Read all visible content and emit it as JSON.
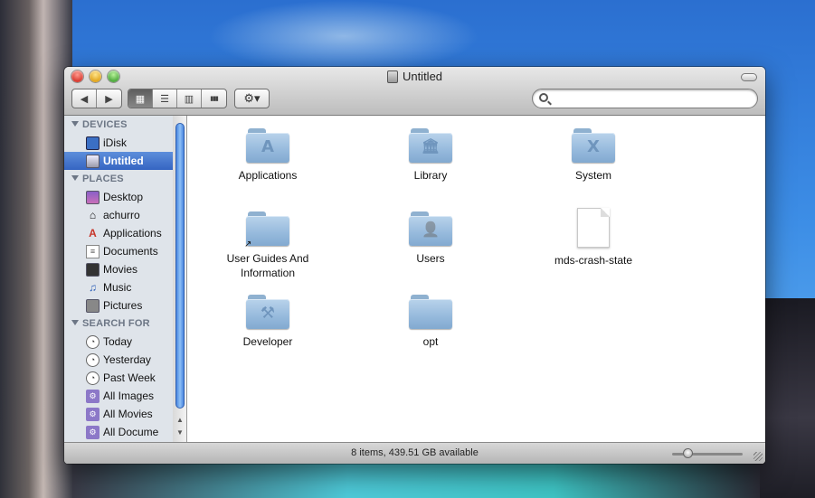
{
  "window": {
    "title": "Untitled"
  },
  "toolbar": {
    "back": "◀",
    "forward": "▶",
    "view_icon": "▦",
    "view_list": "☰",
    "view_columns": "▥",
    "view_coverflow": "▮▮▮",
    "action": "⚙▾",
    "search_placeholder": ""
  },
  "sidebar": {
    "devices_header": "DEVICES",
    "devices": [
      {
        "label": "iDisk",
        "icon": "idisk-icon"
      },
      {
        "label": "Untitled",
        "icon": "hard-drive-icon"
      }
    ],
    "places_header": "PLACES",
    "places": [
      {
        "label": "Desktop",
        "icon": "desktop-icon"
      },
      {
        "label": "achurro",
        "icon": "home-icon"
      },
      {
        "label": "Applications",
        "icon": "applications-icon"
      },
      {
        "label": "Documents",
        "icon": "documents-icon"
      },
      {
        "label": "Movies",
        "icon": "movies-icon"
      },
      {
        "label": "Music",
        "icon": "music-icon"
      },
      {
        "label": "Pictures",
        "icon": "pictures-icon"
      }
    ],
    "search_header": "SEARCH FOR",
    "search": [
      {
        "label": "Today",
        "icon": "clock-icon"
      },
      {
        "label": "Yesterday",
        "icon": "clock-icon"
      },
      {
        "label": "Past Week",
        "icon": "clock-icon"
      },
      {
        "label": "All Images",
        "icon": "smart-folder-icon"
      },
      {
        "label": "All Movies",
        "icon": "smart-folder-icon"
      },
      {
        "label": "All Docume",
        "icon": "smart-folder-icon"
      }
    ]
  },
  "files": [
    {
      "name": "Applications",
      "emblem": "A"
    },
    {
      "name": "Library",
      "emblem": "🏛"
    },
    {
      "name": "System",
      "emblem": "X"
    },
    {
      "name": "User Guides And Information",
      "emblem": ""
    },
    {
      "name": "Users",
      "emblem": "👤"
    },
    {
      "name": "mds-crash-state",
      "emblem": ""
    },
    {
      "name": "Developer",
      "emblem": "⚒"
    },
    {
      "name": "opt",
      "emblem": ""
    }
  ],
  "status": {
    "text": "8 items, 439.51 GB available"
  },
  "colors": {
    "selection": "#3565c2",
    "folder": "#95b9dc",
    "sidebar_bg": "#dfe4ea"
  }
}
